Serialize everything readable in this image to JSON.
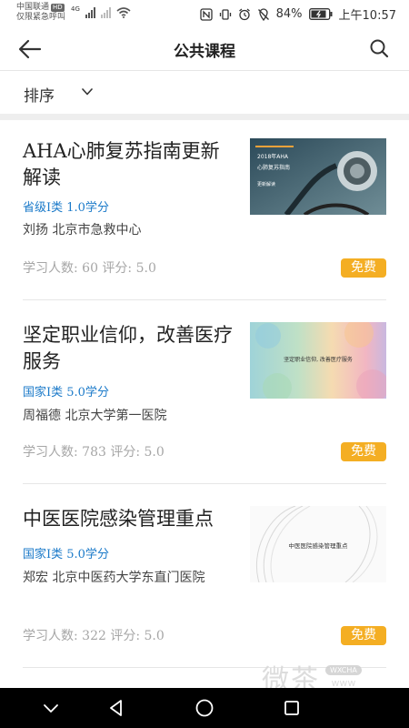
{
  "status_bar": {
    "carrier_line1": "中国联通",
    "hd": "HD",
    "carrier_line2": "仅限紧急呼叫",
    "network": "4G",
    "battery": "84%",
    "time": "上午10:57"
  },
  "header": {
    "title": "公共课程",
    "back_icon": "arrow-left-icon",
    "search_icon": "search-icon"
  },
  "sort": {
    "label": "排序"
  },
  "courses": [
    {
      "title": "AHA心肺复苏指南更新解读",
      "category": "省级I类  1.0学分",
      "author": "刘扬   北京市急救中心",
      "stats": "学习人数: 60   评分: 5.0",
      "badge": "免费",
      "thumb_line1": "2018年AHA",
      "thumb_line2": "心肺复苏指南",
      "thumb_line3": "更新解读"
    },
    {
      "title": "坚定职业信仰，改善医疗服务",
      "category": "国家I类  5.0学分",
      "author": "周福德   北京大学第一医院",
      "stats": "学习人数: 783   评分: 5.0",
      "badge": "免费",
      "thumb_text": "坚定职业信仰, 改善医疗服务"
    },
    {
      "title": "中医医院感染管理重点",
      "category": "国家I类  5.0学分",
      "author": "郑宏   北京中医药大学东直门医院",
      "stats": "学习人数: 322   评分: 5.0",
      "badge": "免费",
      "thumb_text": "中医医院感染管理重点"
    }
  ],
  "watermark": {
    "text": "微茶",
    "badge": "WXCHA",
    "url": "www"
  },
  "colors": {
    "accent_blue": "#1b7ac9",
    "badge_orange": "#f4ae23",
    "stat_gray": "#a6a6a6"
  }
}
